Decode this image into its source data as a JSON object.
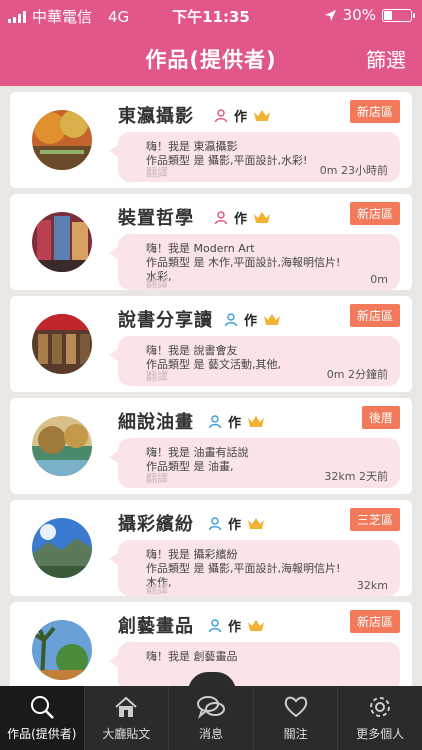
{
  "status_bar": {
    "carrier": "中華電信",
    "network": "4G",
    "time": "下午11:35",
    "battery_text": "30%",
    "battery_level": 0.3
  },
  "nav": {
    "title": "作品(提供者)",
    "filter_label": "篩選"
  },
  "colors": {
    "brand_pink": "#e2578a",
    "badge_orange": "#f27a5b",
    "bubble_pink": "#fbe4e8",
    "crown_gold": "#f2b233",
    "person_blue": "#3b9fd8",
    "person_pink": "#e2578a"
  },
  "cards": [
    {
      "name": "東瀛攝影",
      "person_icon": "person-pink-icon",
      "works_label": "作",
      "badge": "新店區",
      "line1": "嗨！我是 東瀛攝影",
      "line2": "作品類型 是 攝影,平面設計,水彩!",
      "line3": "",
      "translate": "翻譯",
      "info": "0m  23小時前"
    },
    {
      "name": "裝置哲學",
      "person_icon": "person-pink-icon",
      "works_label": "作",
      "badge": "新店區",
      "line1": "嗨！我是 Modern Art",
      "line2": "作品類型 是 木作,平面設計,海報明信片!",
      "line3": "水彩,",
      "translate": "翻譯",
      "info": "0m"
    },
    {
      "name": "說書分享讀",
      "person_icon": "person-blue-icon",
      "works_label": "作",
      "badge": "新店區",
      "line1": "嗨！我是 說書會友",
      "line2": "作品類型 是 藝文活動,其他,",
      "line3": "",
      "translate": "翻譯",
      "info": "0m  2分鐘前"
    },
    {
      "name": "細說油畫",
      "person_icon": "person-blue-icon",
      "works_label": "作",
      "badge": "後厝",
      "line1": "嗨！我是 油畫有話說",
      "line2": "作品類型 是 油畫,",
      "line3": "",
      "translate": "翻譯",
      "info": "32km  2天前"
    },
    {
      "name": "攝彩繽紛",
      "person_icon": "person-blue-icon",
      "works_label": "作",
      "badge": "三芝區",
      "line1": "嗨！我是 攝彩繽紛",
      "line2": "作品類型 是 攝影,平面設計,海報明信片!",
      "line3": "木作,",
      "translate": "翻譯",
      "info": "32km"
    },
    {
      "name": "創藝畫品",
      "person_icon": "person-blue-icon",
      "works_label": "作",
      "badge": "新店區",
      "line1": "嗨！我是 創藝畫品",
      "line2": "",
      "line3": "",
      "translate": "",
      "info": ""
    }
  ],
  "tabs": [
    {
      "label": "作品(提供者)",
      "icon": "search-icon",
      "active": true
    },
    {
      "label": "大廳貼文",
      "icon": "home-icon",
      "active": false
    },
    {
      "label": "消息",
      "icon": "chat-bubbles-icon",
      "active": false
    },
    {
      "label": "關注",
      "icon": "heart-icon",
      "active": false
    },
    {
      "label": "更多個人",
      "icon": "gear-icon",
      "active": false
    }
  ]
}
